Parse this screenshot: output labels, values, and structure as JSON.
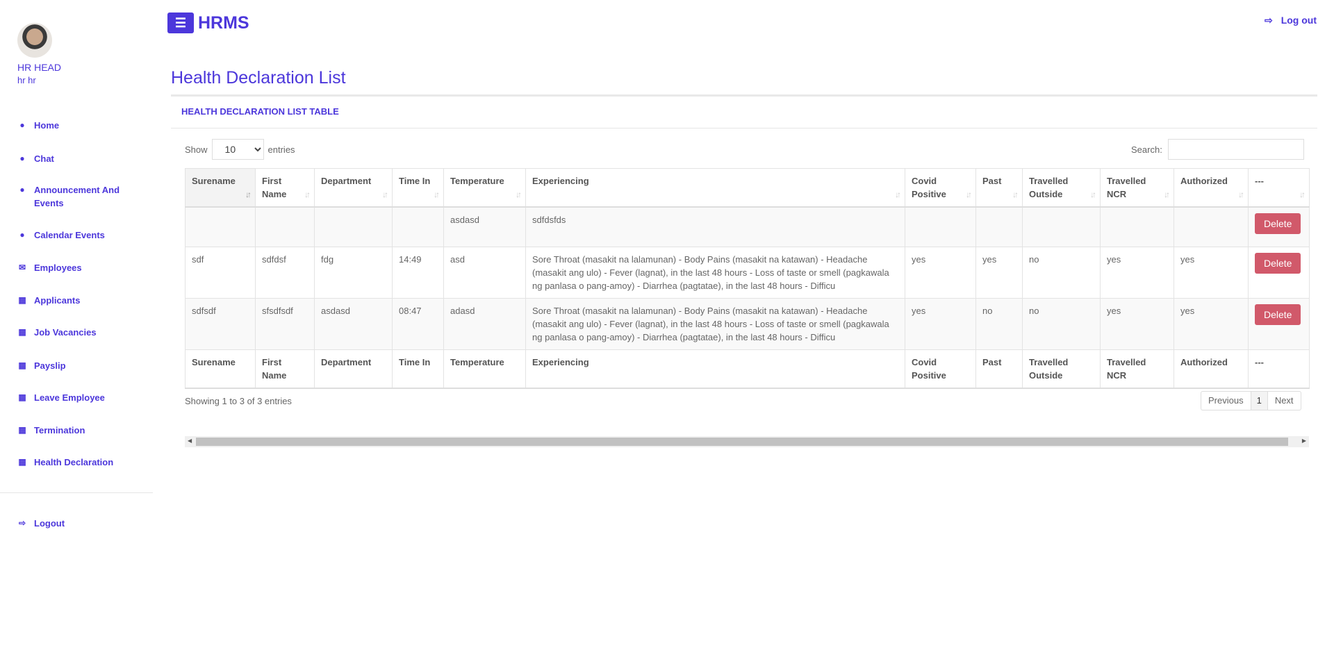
{
  "user": {
    "name": "HR HEAD",
    "role": "hr hr"
  },
  "sidebar": {
    "items": [
      {
        "label": "Home",
        "icon": "user-circle-icon"
      },
      {
        "label": "Chat",
        "icon": "user-circle-icon"
      },
      {
        "label": "Announcement And Events",
        "icon": "user-circle-icon"
      },
      {
        "label": "Calendar Events",
        "icon": "user-circle-icon"
      },
      {
        "label": "Employees",
        "icon": "envelope-icon"
      },
      {
        "label": "Applicants",
        "icon": "table-icon"
      },
      {
        "label": "Job Vacancies",
        "icon": "table-icon"
      },
      {
        "label": "Payslip",
        "icon": "table-icon"
      },
      {
        "label": "Leave Employee",
        "icon": "table-icon"
      },
      {
        "label": "Termination",
        "icon": "table-icon"
      },
      {
        "label": "Health Declaration",
        "icon": "table-icon"
      }
    ],
    "logout": "Logout"
  },
  "header": {
    "brand": "HRMS",
    "menu_icon": "☰",
    "logout": "Log out"
  },
  "page": {
    "title": "Health Declaration List",
    "card_title": "HEALTH DECLARATION LIST TABLE"
  },
  "controls": {
    "show": "Show",
    "entries_value": "10",
    "entries": "entries",
    "search": "Search:",
    "search_value": ""
  },
  "table": {
    "columns": [
      "Surename",
      "First Name",
      "Department",
      "Time In",
      "Temperature",
      "Experiencing",
      "Covid Positive",
      "Past",
      "Travelled Outside",
      "Travelled NCR",
      "Authorized",
      "---"
    ],
    "rows": [
      [
        "",
        "",
        "",
        "",
        "asdasd",
        "sdfdsfds",
        "",
        "",
        "",
        "",
        "",
        "Delete"
      ],
      [
        "sdf",
        "sdfdsf",
        "fdg",
        "14:49",
        "asd",
        "Sore Throat (masakit na lalamunan) - Body Pains (masakit na katawan) - Headache (masakit ang ulo) - Fever (lagnat), in the last 48 hours - Loss of taste or smell (pagkawala ng panlasa o pang-amoy) - Diarrhea (pagtatae), in the last 48 hours - Difficu",
        "yes",
        "yes",
        "no",
        "yes",
        "yes",
        "Delete"
      ],
      [
        "sdfsdf",
        "sfsdfsdf",
        "asdasd",
        "08:47",
        "adasd",
        "Sore Throat (masakit na lalamunan) - Body Pains (masakit na katawan) - Headache (masakit ang ulo) - Fever (lagnat), in the last 48 hours - Loss of taste or smell (pagkawala ng panlasa o pang-amoy) - Diarrhea (pagtatae), in the last 48 hours - Difficu",
        "yes",
        "no",
        "no",
        "yes",
        "yes",
        "Delete"
      ]
    ]
  },
  "footer": {
    "info": "Showing 1 to 3 of 3 entries",
    "previous": "Previous",
    "page": "1",
    "next": "Next"
  },
  "colors": {
    "accent": "#4c37db",
    "danger": "#d1596a"
  }
}
